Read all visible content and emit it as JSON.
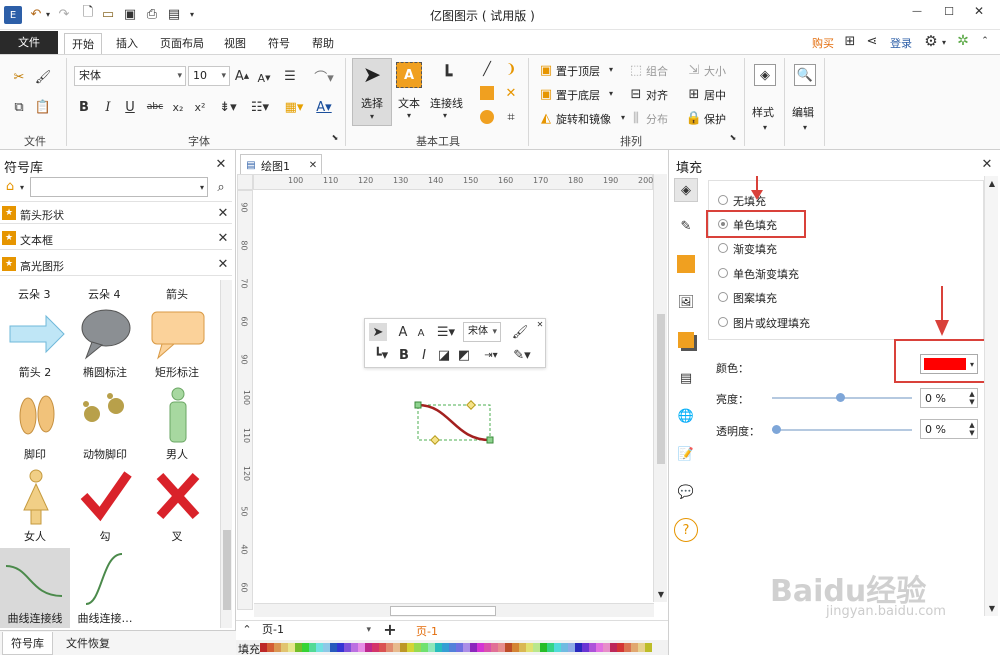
{
  "app": {
    "title": "亿图图示 ( 试用版 )"
  },
  "menu": {
    "file": "文件",
    "tabs": [
      "开始",
      "插入",
      "页面布局",
      "视图",
      "符号",
      "帮助"
    ],
    "buy": "购买",
    "login": "登录"
  },
  "ribbon": {
    "font_name": "宋体",
    "font_size": "10",
    "groups": [
      "文件",
      "字体",
      "基本工具",
      "排列",
      "样式",
      "编辑"
    ],
    "tools": [
      "选择",
      "文本",
      "连接线"
    ],
    "arrange": {
      "bring_front": "置于顶层",
      "send_back": "置于底层",
      "rotate": "旋转和镜像",
      "group": "组合",
      "size": "大小",
      "align": "对齐",
      "center": "居中",
      "distribute": "分布",
      "protect": "保护"
    },
    "style": "样式",
    "edit": "编辑"
  },
  "library": {
    "title": "符号库",
    "sections": [
      "箭头形状",
      "文本框",
      "高光图形"
    ],
    "shapes": [
      "云朵 3",
      "云朵 4",
      "箭头",
      "箭头 2",
      "椭圆标注",
      "矩形标注",
      "脚印",
      "动物脚印",
      "男人",
      "女人",
      "勾",
      "叉",
      "曲线连接线",
      "曲线连接…"
    ],
    "bottom_tabs": [
      "符号库",
      "文件恢复"
    ]
  },
  "document": {
    "tab": "绘图1",
    "ruler_top": [
      "100",
      "110",
      "120",
      "130",
      "140",
      "150",
      "160",
      "170",
      "180",
      "190",
      "200"
    ],
    "ruler_left": [
      "90",
      "80",
      "70",
      "60",
      "90",
      "100",
      "110",
      "120",
      "50",
      "40",
      "60"
    ],
    "page_selector": "页-1",
    "page_tab": "页-1",
    "fill_label": "填充",
    "mini_toolbar_font": "宋体"
  },
  "fill_panel": {
    "title": "填充",
    "options": [
      "无填充",
      "单色填充",
      "渐变填充",
      "单色渐变填充",
      "图案填充",
      "图片或纹理填充"
    ],
    "selected_option": "单色填充",
    "color_label": "颜色：",
    "color_value": "#ff0000",
    "brightness_label": "亮度：",
    "brightness_value": "0 %",
    "transparency_label": "透明度：",
    "transparency_value": "0 %"
  },
  "watermark": {
    "brand": "Baidu经验",
    "url": "jingyan.baidu.com"
  },
  "colors": {
    "accent": "#e36c0a",
    "file_tab": "#2a2a2a",
    "highlight": "#d9413a",
    "curve": "#a3201f"
  }
}
